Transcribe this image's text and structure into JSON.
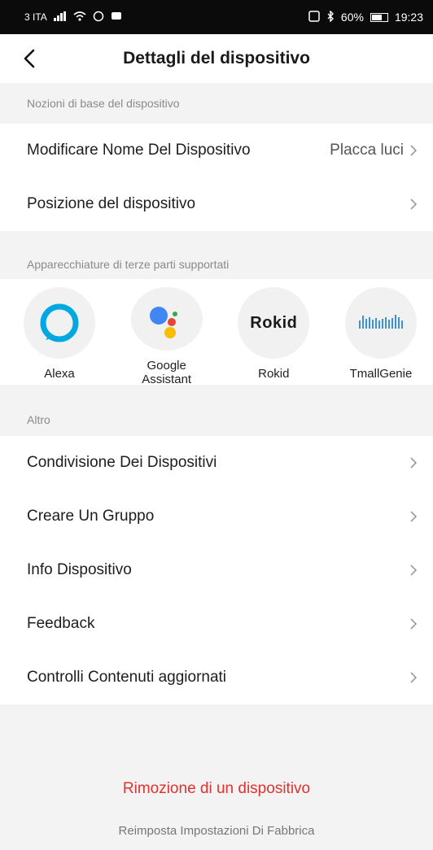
{
  "status_bar": {
    "carrier": "3 ITA",
    "battery": "60%",
    "time": "19:23",
    "left_icons": [
      "signal-icon",
      "wifi-icon",
      "whatsapp-icon",
      "message-icon"
    ],
    "right_icons": [
      "nfc-icon",
      "bluetooth-icon",
      "battery-icon"
    ]
  },
  "header": {
    "title": "Dettagli del dispositivo",
    "back_icon": "chevron-left-icon"
  },
  "basic": {
    "section_label": "Nozioni di base del dispositivo",
    "rows": [
      {
        "label": "Modificare Nome Del Dispositivo",
        "value": "Placca luci"
      },
      {
        "label": "Posizione del dispositivo",
        "value": ""
      }
    ]
  },
  "third_party": {
    "section_label": "Apparecchiature di terze parti supportati",
    "items": [
      {
        "name": "Alexa",
        "icon": "alexa-icon"
      },
      {
        "name": "Google Assistant",
        "icon": "google-assistant-icon"
      },
      {
        "name": "Rokid",
        "icon": "rokid-logo",
        "logo_text": "Rokid"
      },
      {
        "name": "TmallGenie",
        "icon": "tmallgenie-icon"
      }
    ]
  },
  "other": {
    "section_label": "Altro",
    "rows": [
      {
        "label": "Condivisione Dei Dispositivi"
      },
      {
        "label": "Creare Un Gruppo"
      },
      {
        "label": "Info Dispositivo"
      },
      {
        "label": "Feedback"
      },
      {
        "label": "Controlli Contenuti aggiornati"
      }
    ]
  },
  "actions": {
    "remove_label": "Rimozione di un dispositivo",
    "factory_reset_label": "Reimposta Impostazioni Di Fabbrica"
  },
  "colors": {
    "danger": "#e0322e",
    "background": "#f3f3f3",
    "alexa_blue": "#00a8e1",
    "google_blue": "#4285f4",
    "google_red": "#ea4335",
    "google_yellow": "#fbbc05",
    "google_green": "#34a853"
  }
}
